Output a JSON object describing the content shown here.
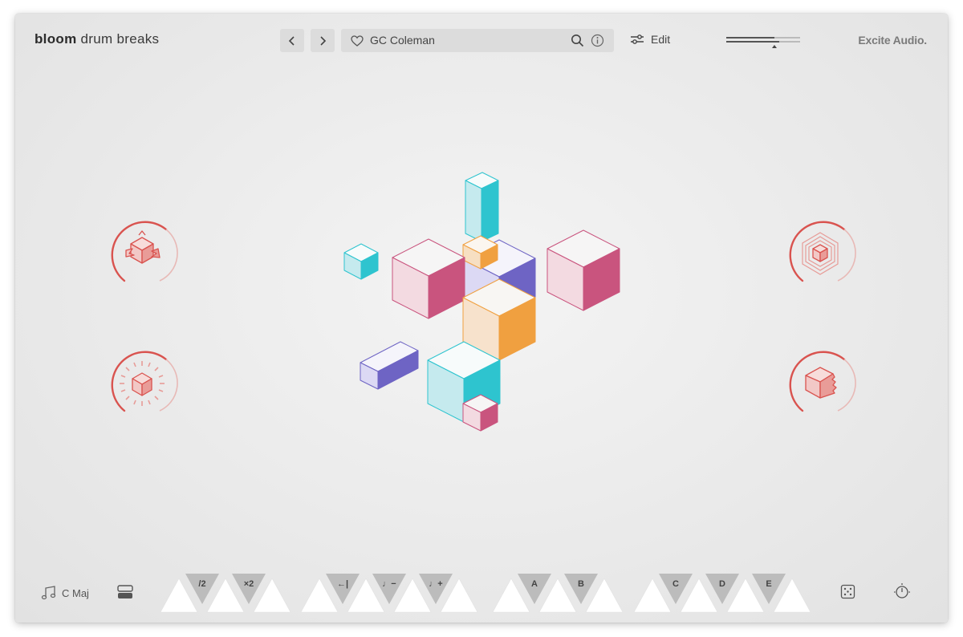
{
  "header": {
    "brand_bold": "bloom",
    "brand_rest": "drum breaks",
    "preset_name": "GC Coleman",
    "edit_label": "Edit",
    "maker": "Excite Audio."
  },
  "footer": {
    "key_label": "C Maj"
  },
  "pads": {
    "group1": [
      "/2",
      "×2"
    ],
    "group2": [
      "←|",
      "♩−",
      "♩+"
    ],
    "group3": [
      "A",
      "B"
    ],
    "group4": [
      "C",
      "D",
      "E"
    ]
  },
  "colors": {
    "accent_red": "#d9534f",
    "cube_pink": "#c9547e",
    "cube_cyan": "#2ec4cf",
    "cube_orange": "#f0a040",
    "cube_purple": "#6e64c4"
  }
}
